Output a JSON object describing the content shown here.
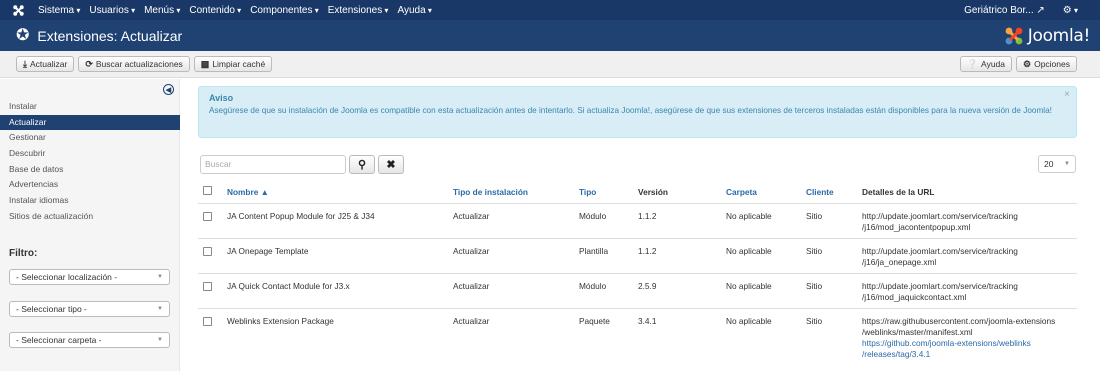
{
  "navbar": {
    "menu": [
      "Sistema",
      "Usuarios",
      "Menús",
      "Contenido",
      "Componentes",
      "Extensiones",
      "Ayuda"
    ],
    "site_name": "Geriátrico Bor...",
    "logo_icon": "joomla-icon",
    "external_icon": "external-link-icon",
    "gear_icon": "gear-icon"
  },
  "titlebar": {
    "icon": "puzzle-icon",
    "title": "Extensiones: Actualizar",
    "brand": "Joomla!"
  },
  "toolbar": {
    "update_label": "Actualizar",
    "find_updates_label": "Buscar actualizaciones",
    "purge_cache_label": "Limpiar caché",
    "help_label": "Ayuda",
    "options_label": "Opciones"
  },
  "sidebar": {
    "items": [
      {
        "label": "Instalar",
        "active": false
      },
      {
        "label": "Actualizar",
        "active": true
      },
      {
        "label": "Gestionar",
        "active": false
      },
      {
        "label": "Descubrir",
        "active": false
      },
      {
        "label": "Base de datos",
        "active": false
      },
      {
        "label": "Advertencias",
        "active": false
      },
      {
        "label": "Instalar idiomas",
        "active": false
      },
      {
        "label": "Sitios de actualización",
        "active": false
      }
    ],
    "filter_label": "Filtro:",
    "filters": [
      "- Seleccionar localización -",
      "- Seleccionar tipo -",
      "- Seleccionar carpeta -"
    ]
  },
  "alert": {
    "heading": "Aviso",
    "text": "Asegúrese de que su instalación de Joomla es compatible con esta actualización antes de intentarlo. Si actualiza Joomla!, asegúrese de que sus extensiones de terceros instaladas están disponibles para la nueva versión de Joomla!",
    "close": "×"
  },
  "search": {
    "placeholder": "Buscar",
    "limit": "20"
  },
  "table": {
    "headers": {
      "name": "Nombre ▲",
      "install_type": "Tipo de instalación",
      "type": "Tipo",
      "version": "Versión",
      "folder": "Carpeta",
      "client": "Cliente",
      "details_url": "Detalles de la URL"
    },
    "rows": [
      {
        "name": "JA Content Popup Module for J25 & J34",
        "install_type": "Actualizar",
        "type": "Módulo",
        "version": "1.1.2",
        "folder": "No aplicable",
        "client": "Sitio",
        "url_line1": "http://update.joomlart.com/service/tracking",
        "url_line2": "/j16/mod_jacontentpopup.xml",
        "link_line1": "",
        "link_line2": ""
      },
      {
        "name": "JA Onepage Template",
        "install_type": "Actualizar",
        "type": "Plantilla",
        "version": "1.1.2",
        "folder": "No aplicable",
        "client": "Sitio",
        "url_line1": "http://update.joomlart.com/service/tracking",
        "url_line2": "/j16/ja_onepage.xml",
        "link_line1": "",
        "link_line2": ""
      },
      {
        "name": "JA Quick Contact Module for J3.x",
        "install_type": "Actualizar",
        "type": "Módulo",
        "version": "2.5.9",
        "folder": "No aplicable",
        "client": "Sitio",
        "url_line1": "http://update.joomlart.com/service/tracking",
        "url_line2": "/j16/mod_jaquickcontact.xml",
        "link_line1": "",
        "link_line2": ""
      },
      {
        "name": "Weblinks Extension Package",
        "install_type": "Actualizar",
        "type": "Paquete",
        "version": "3.4.1",
        "folder": "No aplicable",
        "client": "Sitio",
        "url_line1": "https://raw.githubusercontent.com/joomla-extensions",
        "url_line2": "/weblinks/master/manifest.xml",
        "link_line1": "https://github.com/joomla-extensions/weblinks",
        "link_line2": "/releases/tag/3.4.1"
      }
    ]
  },
  "colors": {
    "navbar": "#1a3867",
    "titlebar": "#1f4273",
    "active": "#1f4273",
    "link": "#2a6aa8",
    "alert_bg": "#d9edf7"
  }
}
